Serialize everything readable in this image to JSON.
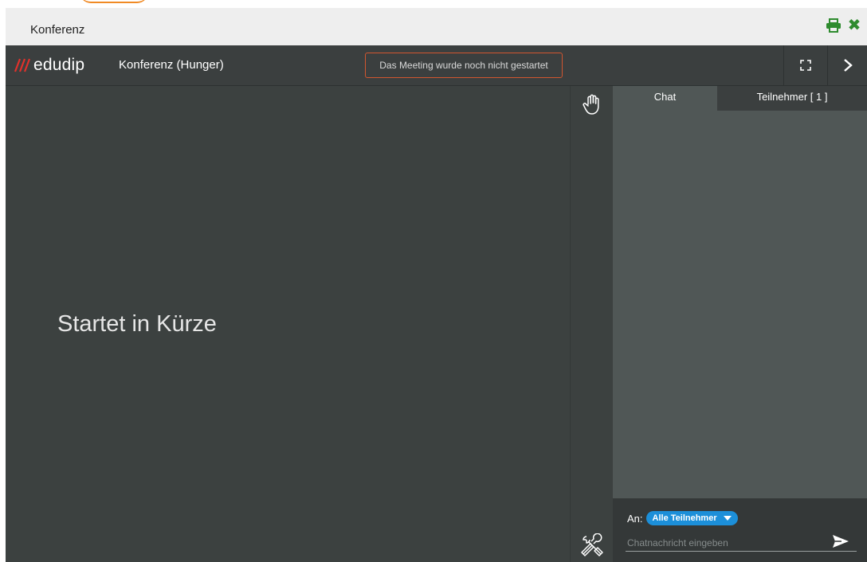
{
  "dialog": {
    "title": "Konferenz"
  },
  "app_bar": {
    "logo_text": "edudip",
    "meeting_title": "Konferenz (Hunger)",
    "status_message": "Das Meeting wurde noch nicht gestartet"
  },
  "stage": {
    "message": "Startet in Kürze"
  },
  "panel": {
    "tabs": [
      {
        "label": "Chat",
        "active": true
      },
      {
        "label": "Teilnehmer [ 1 ]",
        "active": false
      }
    ],
    "chat": {
      "to_label": "An:",
      "recipient": "Alle Teilnehmer",
      "input_placeholder": "Chatnachricht eingeben"
    }
  },
  "icons": {
    "print": "print-icon",
    "close": "close-icon",
    "fullscreen": "fullscreen-icon",
    "next": "chevron-right-icon",
    "hand": "raise-hand-icon",
    "tools": "tools-icon",
    "send": "send-icon"
  },
  "colors": {
    "accent_green": "#2e8b2e",
    "brand_red": "#e0312b",
    "status_border": "#d2562f",
    "recipient_blue": "#1c8fd9"
  }
}
